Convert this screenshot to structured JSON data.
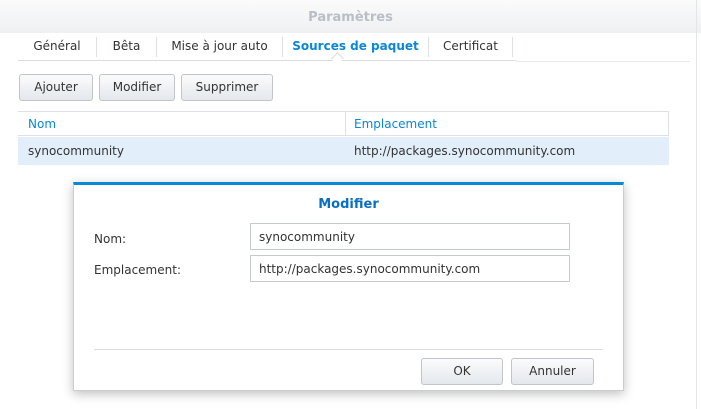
{
  "window": {
    "title": "Paramètres"
  },
  "tabs": [
    {
      "label": "Général"
    },
    {
      "label": "Bêta"
    },
    {
      "label": "Mise à jour auto"
    },
    {
      "label": "Sources de paquet",
      "active": true
    },
    {
      "label": "Certificat"
    }
  ],
  "toolbar": {
    "add_label": "Ajouter",
    "edit_label": "Modifier",
    "delete_label": "Supprimer"
  },
  "grid": {
    "columns": [
      "Nom",
      "Emplacement"
    ],
    "rows": [
      {
        "name": "synocommunity",
        "location": "http://packages.synocommunity.com"
      }
    ]
  },
  "dialog": {
    "title": "Modifier",
    "name_label": "Nom:",
    "name_value": "synocommunity",
    "location_label": "Emplacement:",
    "location_value": "http://packages.synocommunity.com",
    "ok_label": "OK",
    "cancel_label": "Annuler"
  },
  "colors": {
    "accent": "#0a87d6",
    "selection": "#e2effa"
  }
}
